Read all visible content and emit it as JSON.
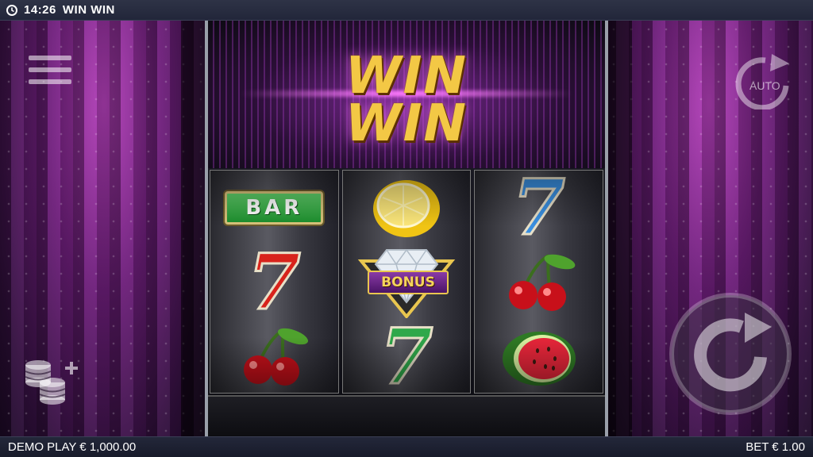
{
  "topbar": {
    "time": "14:26",
    "title": "WIN WIN"
  },
  "logo": {
    "line1": "WIN",
    "line2": "WIN"
  },
  "reels": [
    {
      "symbols": [
        "bar",
        "seven-red",
        "cherry"
      ]
    },
    {
      "symbols": [
        "lemon",
        "bonus-diamond",
        "seven-green"
      ]
    },
    {
      "symbols": [
        "seven-blue",
        "cherry",
        "watermelon"
      ]
    }
  ],
  "symbol_text": {
    "bar": "BAR",
    "seven": "7",
    "bonus": "BONUS"
  },
  "controls": {
    "auto_label": "AUTO"
  },
  "bottombar": {
    "balance": "DEMO PLAY € 1,000.00",
    "bet": "BET € 1.00"
  },
  "colors": {
    "curtain": "#6d1e7a",
    "gold": "#f3c845",
    "bar_green": "#1d8f2e"
  }
}
